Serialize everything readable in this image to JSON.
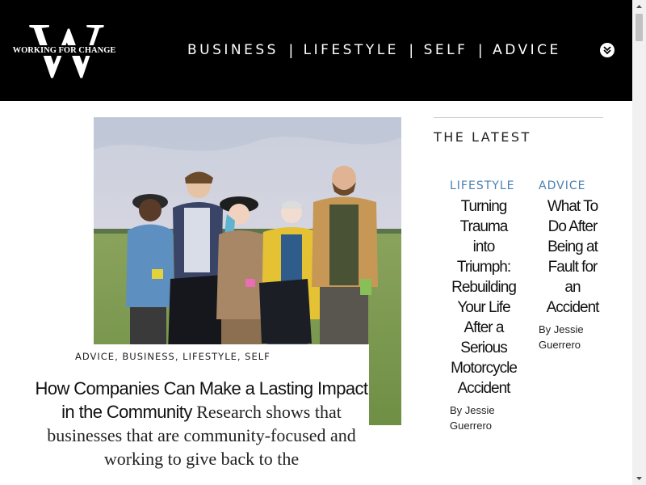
{
  "brand": {
    "logo_letter": "W",
    "logo_text": "WORKING FOR CHANGE"
  },
  "nav": {
    "items": [
      "BUSINESS",
      "LIFESTYLE",
      "SELF",
      "ADVICE"
    ],
    "separator": "|",
    "toggle_icon": "chevron-double-down-icon"
  },
  "featured": {
    "categories": "ADVICE, BUSINESS, LIFESTYLE, SELF",
    "title": "How Companies Can Make a Lasting Impact in the Community",
    "excerpt": "Research shows that businesses that are community-focused and working to give back to the"
  },
  "sidebar": {
    "heading": "THE LATEST",
    "posts": [
      {
        "category": "LIFESTYLE",
        "title": "Turning Trauma into Triumph: Rebuilding Your Life After a Serious Motorcycle Accident",
        "byline": "By Jessie Guerrero"
      },
      {
        "category": "ADVICE",
        "title": "What To Do After Being at Fault for an Accident",
        "byline": "By Jessie Guerrero"
      }
    ]
  },
  "colors": {
    "header_bg": "#000000",
    "category_accent": "#4a7fb3"
  }
}
